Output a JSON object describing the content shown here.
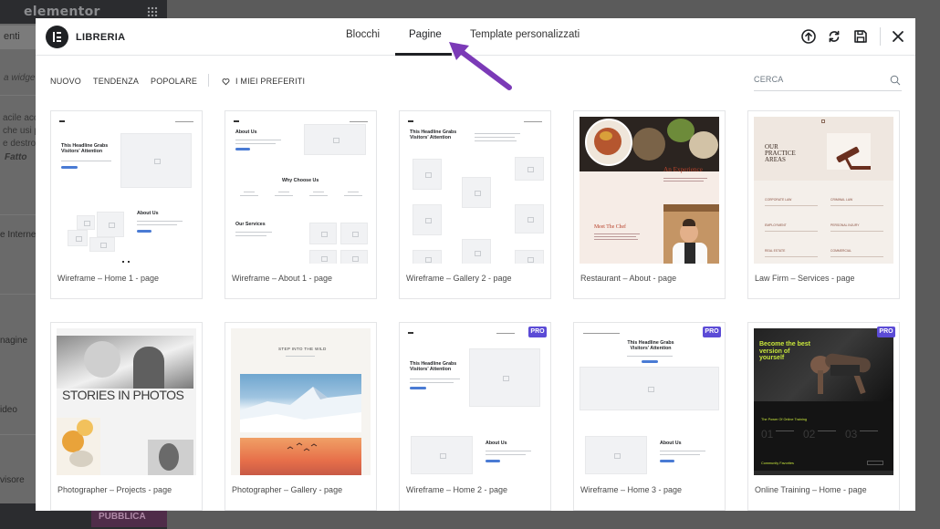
{
  "background": {
    "logo": "elementor",
    "tab_label": "enti",
    "search_placeholder": "a widget...",
    "text_lines": [
      "acile acc",
      "che usi p",
      "e destro"
    ],
    "done_label": "Fatto",
    "widgets": [
      "e Interne",
      "nagine",
      "ideo",
      "visore"
    ],
    "publish_label": "PUBBLICA"
  },
  "header": {
    "title": "LIBRERIA",
    "tabs": {
      "blocks": "Blocchi",
      "pages": "Pagine",
      "custom": "Template personalizzati"
    },
    "active_tab": "pages"
  },
  "filters": {
    "new": "NUOVO",
    "trend": "TENDENZA",
    "popular": "POPOLARE",
    "favorites": "I MIEI PREFERITI"
  },
  "search": {
    "placeholder": "CERCA"
  },
  "templates": [
    {
      "label": "Wireframe – Home 1 - page",
      "pro": false
    },
    {
      "label": "Wireframe – About 1 - page",
      "pro": false
    },
    {
      "label": "Wireframe – Gallery 2 - page",
      "pro": false
    },
    {
      "label": "Restaurant – About - page",
      "pro": false
    },
    {
      "label": "Law Firm – Services - page",
      "pro": false
    },
    {
      "label": "Photographer – Projects - page",
      "pro": false
    },
    {
      "label": "Photographer – Gallery - page",
      "pro": false
    },
    {
      "label": "Wireframe – Home 2 - page",
      "pro": true
    },
    {
      "label": "Wireframe – Home 3 - page",
      "pro": true
    },
    {
      "label": "Online Training – Home - page",
      "pro": true
    }
  ],
  "thumb_text": {
    "headline": "This Headline Grabs Visitors' Attention",
    "about": "About Us",
    "why": "Why Choose Us",
    "services": "Our Services",
    "experience": "An Experience",
    "chef": "Meet The Chef",
    "practice": "OUR PRACTICE AREAS",
    "law": [
      "CORPORATE LAW",
      "CRIMINAL LAW",
      "EMPLOYMENT",
      "PERSONAL INJURY",
      "REAL ESTATE",
      "COMMERCIAL"
    ],
    "stories": "STORIES IN PHOTOS",
    "wild": "STEP INTO THE WILD",
    "fitness": "Become the best version of yourself",
    "training": "The Power Of Online Training",
    "favorites": "Community Favorites",
    "numbers": [
      "01",
      "02",
      "03"
    ]
  },
  "pro_label": "PRO",
  "colors": {
    "accent": "#5b4bd6",
    "arrow": "#7b3ab7",
    "button_blue": "#4a7bd4",
    "fitness_green": "#c8e63c"
  }
}
